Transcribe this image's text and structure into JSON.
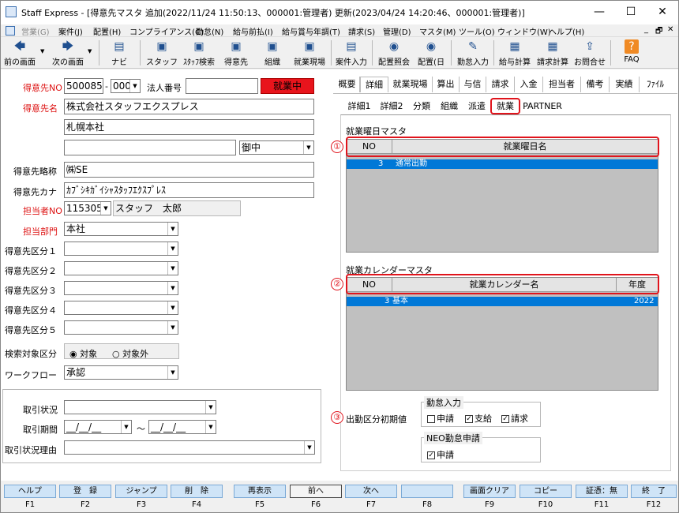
{
  "window": {
    "title": "Staff Express - [得意先マスタ 追加(2022/11/24 11:50:13、000001:管理者) 更新(2023/04/24 14:20:46、000001:管理者)]",
    "minimize": "—",
    "maximize": "☐",
    "close": "✕"
  },
  "menu": [
    "営業(G)",
    "案件(J)",
    "配置(H)",
    "コンプライアンス(C)",
    "勤怠(N)",
    "給与前払(I)",
    "給与賞与年調(T)",
    "請求(S)",
    "管理(D)",
    "マスタ(M)",
    "ツール(O)",
    "ウィンドウ(W)",
    "ヘルプ(H)"
  ],
  "menu_right": [
    "_",
    "🗗",
    "✕"
  ],
  "toolbar": [
    {
      "label": "前の画面",
      "icon": "arrow-left-icon",
      "glyph": "🡄"
    },
    {
      "label": "次の画面",
      "icon": "arrow-right-icon",
      "glyph": "🡆"
    },
    {
      "label": "ナビ",
      "icon": "navi-icon",
      "glyph": "▤"
    },
    {
      "label": "スタッフ",
      "icon": "staff-icon",
      "glyph": "▣"
    },
    {
      "label": "ｽﾀｯﾌ検索",
      "icon": "staff-search-icon",
      "glyph": "▣"
    },
    {
      "label": "得意先",
      "icon": "client-icon",
      "glyph": "▣"
    },
    {
      "label": "組織",
      "icon": "org-icon",
      "glyph": "▣"
    },
    {
      "label": "就業現場",
      "icon": "workplace-icon",
      "glyph": "▣"
    },
    {
      "label": "案件入力",
      "icon": "case-input-icon",
      "glyph": "▤"
    },
    {
      "label": "配置照会",
      "icon": "placement-query-icon",
      "glyph": "◉"
    },
    {
      "label": "配置(日",
      "icon": "placement-day-icon",
      "glyph": "◉"
    },
    {
      "label": "勤怠入力",
      "icon": "attendance-input-icon",
      "glyph": "✎"
    },
    {
      "label": "給与計算",
      "icon": "payroll-icon",
      "glyph": "▦"
    },
    {
      "label": "請求計算",
      "icon": "billing-icon",
      "glyph": "▦"
    },
    {
      "label": "お問合せ",
      "icon": "inquiry-icon",
      "glyph": "⇪"
    },
    {
      "label": "FAQ",
      "icon": "faq-icon",
      "glyph": "?"
    }
  ],
  "form": {
    "client_no_label": "得意先NO",
    "client_no": "500085",
    "branch": "000",
    "dash": "-",
    "corp_no_label": "法人番号",
    "corp_no": "",
    "status_badge": "就業中",
    "client_name_label": "得意先名",
    "client_name": "株式会社スタッフエクスプレス",
    "client_name2": "札幌本社",
    "client_name3": "",
    "honorific": "御中",
    "short_name_label": "得意先略称",
    "short_name": "㈱SE",
    "kana_label": "得意先カナ",
    "kana": "ｶﾌﾞｼｷｶﾞｲｼｬｽﾀｯﾌｴｸｽﾌﾟﾚｽ",
    "rep_no_label": "担当者NO",
    "rep_no": "115305",
    "rep_name": "スタッフ　太郎",
    "dept_label": "担当部門",
    "dept": "本社",
    "cat_labels": [
      "得意先区分１",
      "得意先区分２",
      "得意先区分３",
      "得意先区分４",
      "得意先区分５"
    ],
    "search_label": "検索対象区分",
    "radio_on": "対象",
    "radio_off": "対象外",
    "workflow_label": "ワークフロー",
    "workflow": "承認",
    "deal_status_label": "取引状況",
    "deal_period_label": "取引期間",
    "date_from": "__/__/__",
    "tilde": "～",
    "date_to": "__/__/__",
    "deal_reason_label": "取引状況理由"
  },
  "tabs": [
    "概要",
    "詳細",
    "就業現場",
    "算出",
    "与信",
    "請求",
    "入金",
    "担当者",
    "備考",
    "実績",
    "ﾌｧｲﾙ"
  ],
  "subtabs": [
    "詳細1",
    "詳細2",
    "分類",
    "組織",
    "派遣",
    "就業",
    "PARTNER"
  ],
  "work_day": {
    "title": "就業曜日マスタ",
    "marker": "①",
    "col_no": "NO",
    "col_name": "就業曜日名",
    "rows": [
      {
        "no": "3",
        "name": "通常出勤"
      }
    ]
  },
  "work_cal": {
    "title": "就業カレンダーマスタ",
    "marker": "②",
    "col_no": "NO",
    "col_name": "就業カレンダー名",
    "col_year": "年度",
    "rows": [
      {
        "no": "3",
        "name": "基本",
        "year": "2022"
      }
    ]
  },
  "absence": {
    "marker": "③",
    "label": "出勤区分初期値",
    "group1": "勤怠入力",
    "cb1": "申請",
    "cb2": "支給",
    "cb3": "請求",
    "group2": "NEO勤怠申請",
    "cb4": "申請"
  },
  "fkeys": [
    {
      "label": "ヘルプ",
      "key": "F1"
    },
    {
      "label": "登　録",
      "key": "F2"
    },
    {
      "label": "ジャンプ",
      "key": "F3"
    },
    {
      "label": "削　除",
      "key": "F4"
    },
    {
      "label": "再表示",
      "key": "F5"
    },
    {
      "label": "前へ",
      "key": "F6"
    },
    {
      "label": "次へ",
      "key": "F7"
    },
    {
      "label": "",
      "key": "F8"
    },
    {
      "label": "画面クリア",
      "key": "F9"
    },
    {
      "label": "コピー",
      "key": "F10"
    },
    {
      "label": "証憑：無",
      "key": "F11"
    },
    {
      "label": "終　了",
      "key": "F12"
    }
  ]
}
